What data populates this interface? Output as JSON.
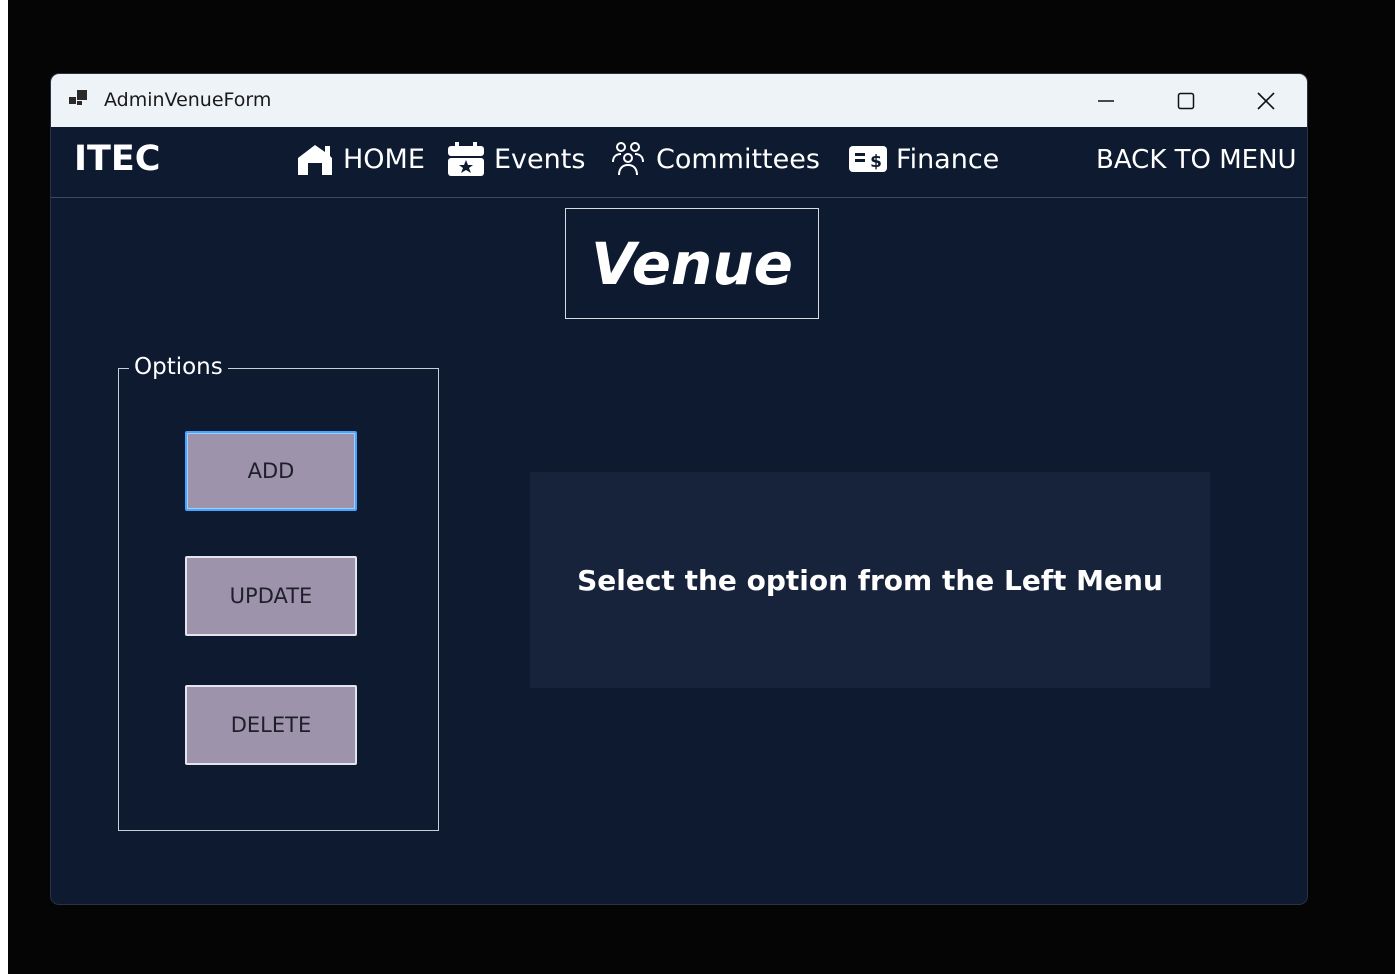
{
  "window": {
    "title": "AdminVenueForm",
    "controls": [
      "minimize",
      "maximize",
      "close"
    ]
  },
  "navbar": {
    "brand": "ITEC",
    "items": [
      {
        "label": "HOME",
        "icon": "home-icon"
      },
      {
        "label": "Events",
        "icon": "calendar-star-icon"
      },
      {
        "label": "Committees",
        "icon": "people-group-icon"
      },
      {
        "label": "Finance",
        "icon": "finance-card-icon"
      }
    ],
    "back_label": "BACK TO MENU"
  },
  "page": {
    "title": "Venue"
  },
  "options": {
    "legend": "Options",
    "buttons": [
      {
        "label": "ADD"
      },
      {
        "label": "UPDATE"
      },
      {
        "label": "DELETE"
      }
    ]
  },
  "info": {
    "message": "Select the option from the Left Menu"
  },
  "colors": {
    "background": "#0d1a30",
    "panel": "#17233a",
    "button": "#9d93ab",
    "text": "#ffffff"
  }
}
